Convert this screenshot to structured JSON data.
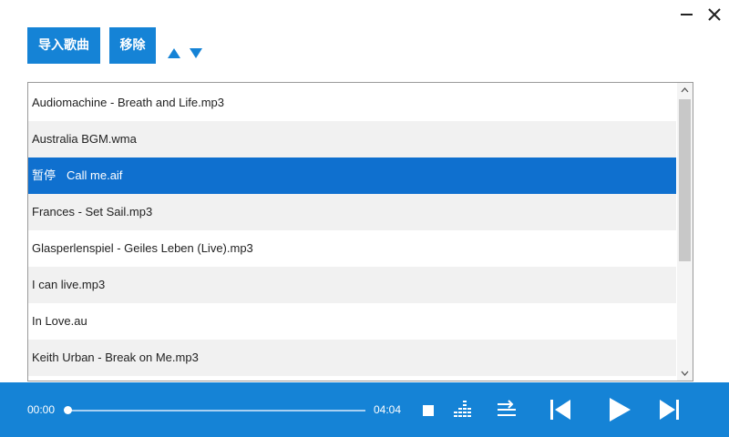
{
  "toolbar": {
    "import_label": "导入歌曲",
    "remove_label": "移除"
  },
  "playlist": {
    "items": [
      {
        "title": "Audiomachine - Breath and Life.mp3",
        "status": ""
      },
      {
        "title": "Australia BGM.wma",
        "status": ""
      },
      {
        "title": "Call me.aif",
        "status": "暂停"
      },
      {
        "title": "Frances - Set Sail.mp3",
        "status": ""
      },
      {
        "title": "Glasperlenspiel - Geiles Leben (Live).mp3",
        "status": ""
      },
      {
        "title": "I can live.mp3",
        "status": ""
      },
      {
        "title": "In Love.au",
        "status": ""
      },
      {
        "title": "Keith Urban - Break on Me.mp3",
        "status": ""
      }
    ],
    "selected_index": 2
  },
  "player": {
    "current_time": "00:00",
    "total_time": "04:04",
    "progress": 0
  },
  "colors": {
    "accent": "#1583d6",
    "selection": "#0f70cf",
    "row_alt": "#f1f1f1"
  },
  "icons": {
    "minimize": "minimize-icon",
    "close": "close-icon",
    "move_up": "triangle-up-icon",
    "move_down": "triangle-down-icon",
    "stop": "stop-icon",
    "equalizer": "equalizer-icon",
    "play_mode": "play-mode-icon",
    "previous": "previous-icon",
    "play": "play-icon",
    "next": "next-icon"
  }
}
